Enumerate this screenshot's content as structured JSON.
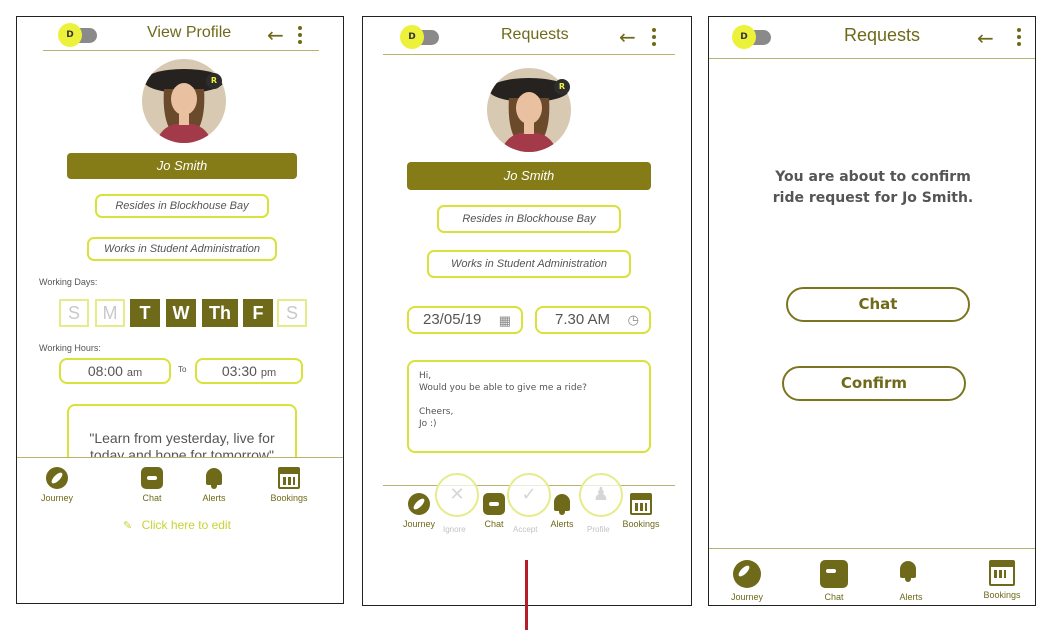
{
  "toggle_letter": "D",
  "avatar_badge": "R",
  "accent_colors": {
    "olive": "#6f6a1a",
    "bar": "#857c18",
    "lime": "#d8e23a"
  },
  "profile": {
    "title": "View Profile",
    "name": "Jo Smith",
    "resides": "Resides in Blockhouse Bay",
    "works": "Works in Student Administration",
    "working_days_label": "Working Days:",
    "days": [
      {
        "label": "S",
        "active": false
      },
      {
        "label": "M",
        "active": false
      },
      {
        "label": "T",
        "active": true
      },
      {
        "label": "W",
        "active": true
      },
      {
        "label": "Th",
        "active": true
      },
      {
        "label": "F",
        "active": true
      },
      {
        "label": "S",
        "active": false
      }
    ],
    "working_hours_label": "Working Hours:",
    "start_time": "08:00",
    "start_ampm": "am",
    "to_label": "To",
    "end_time": "03:30",
    "end_ampm": "pm",
    "quote_line1": "\"Learn from yesterday, live for",
    "quote_line2": "today and hope for tomorrow\"",
    "edit_link": "Click here to edit"
  },
  "request": {
    "title": "Requests",
    "name": "Jo Smith",
    "resides": "Resides in Blockhouse Bay",
    "works": "Works in Student Administration",
    "date": "23/05/19",
    "time": "7.30 AM",
    "message_lines": [
      "Hi,",
      "Would you be able to give me a ride?",
      "",
      "Cheers,",
      "Jo :)"
    ],
    "actions": [
      "Ignore",
      "Accept",
      "Profile"
    ]
  },
  "confirm": {
    "title": "Requests",
    "message_line1": "You are about to confirm",
    "message_line2": "ride request for Jo Smith.",
    "chat_button": "Chat",
    "confirm_button": "Confirm"
  },
  "nav": {
    "journey": "Journey",
    "chat": "Chat",
    "alerts": "Alerts",
    "bookings": "Bookings"
  },
  "icons": [
    "back-arrow-icon",
    "kebab-menu-icon",
    "journey-icon",
    "chat-icon",
    "alerts-bell-icon",
    "bookings-calendar-icon",
    "calendar-icon",
    "clock-icon",
    "pencil-icon",
    "x-icon",
    "check-icon",
    "person-icon"
  ]
}
